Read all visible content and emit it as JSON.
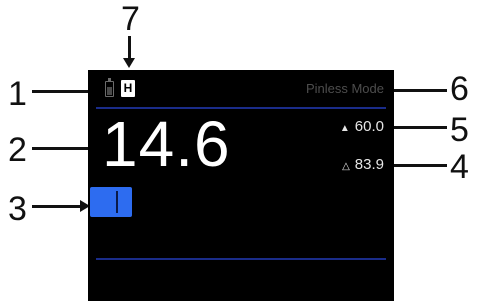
{
  "callouts": [
    "1",
    "2",
    "3",
    "4",
    "5",
    "6",
    "7"
  ],
  "status": {
    "battery_icon": "battery-icon",
    "hold_badge": "H",
    "mode_label": "Pinless Mode"
  },
  "reading": {
    "value": "14.6"
  },
  "stats": {
    "max_glyph": "▲",
    "max_value": "60.0",
    "diff_glyph": "△",
    "diff_value": "83.9"
  },
  "bar_graph": {
    "icon": "bar-graph-icon"
  },
  "colors": {
    "screen_bg": "#000000",
    "separator": "#1a2c8a",
    "bar": "#2d6cf0",
    "reading": "#ffffff"
  }
}
